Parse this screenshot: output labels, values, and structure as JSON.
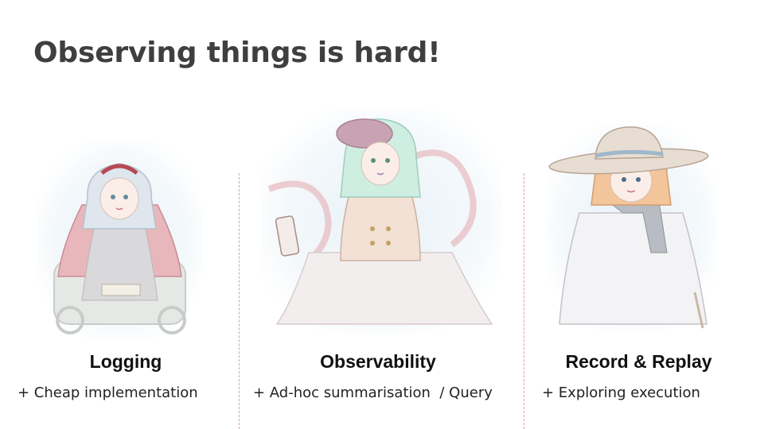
{
  "slide": {
    "title": "Observing things is hard!"
  },
  "columns": [
    {
      "heading": "Logging",
      "point": "+ Cheap implementation",
      "illustration": "girl-red-cape-wheelchair-illustration"
    },
    {
      "heading": "Observability",
      "point": "+ Ad-hoc summarisation  / Query",
      "illustration": "girl-beret-holding-phone-illustration"
    },
    {
      "heading": "Record & Replay",
      "point": "+ Exploring execution",
      "illustration": "girl-wide-hat-scarf-illustration"
    }
  ],
  "colors": {
    "title": "#3f3f3f",
    "divider": "#d9a3a8",
    "heading": "#111111",
    "body_text": "#222222"
  }
}
